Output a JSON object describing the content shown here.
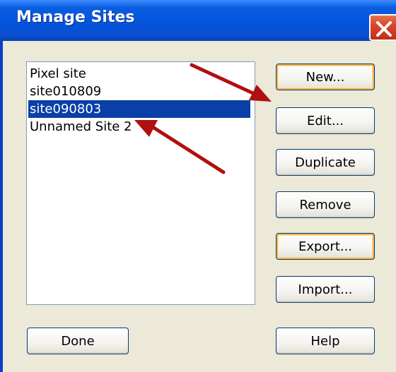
{
  "window": {
    "title": "Manage Sites"
  },
  "sites": [
    {
      "label": "Pixel site",
      "selected": false
    },
    {
      "label": "site010809",
      "selected": false
    },
    {
      "label": "site090803",
      "selected": true
    },
    {
      "label": "Unnamed Site 2",
      "selected": false
    }
  ],
  "buttons": {
    "new": "New...",
    "edit": "Edit...",
    "duplicate": "Duplicate",
    "remove": "Remove",
    "export": "Export...",
    "import": "Import...",
    "done": "Done",
    "help": "Help"
  },
  "colors": {
    "selection": "#0a3fa8",
    "arrow": "#b01010",
    "focus_ring": "#f8b34a"
  },
  "icons": {
    "close": "close-icon",
    "annotation_arrows": "arrow-icon"
  }
}
